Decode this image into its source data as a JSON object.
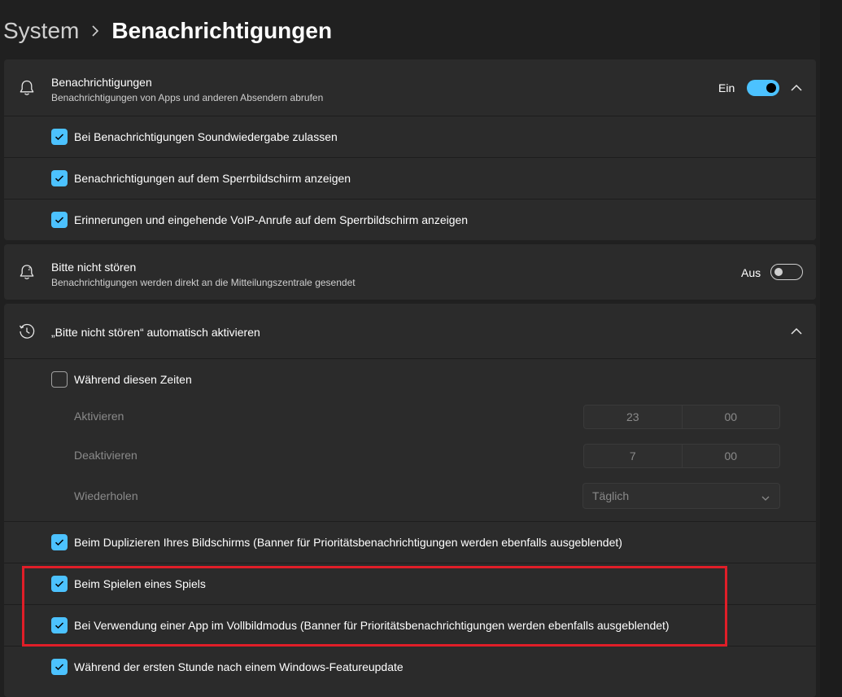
{
  "breadcrumb": {
    "parent": "System",
    "separator_icon": "chevron-right-icon",
    "current": "Benachrichtigungen"
  },
  "notifications": {
    "icon": "bell-icon",
    "title": "Benachrichtigungen",
    "subtitle": "Benachrichtigungen von Apps und anderen Absendern abrufen",
    "state_label": "Ein",
    "toggle_on": true,
    "expanded_icon": "chevron-up-icon",
    "options": [
      {
        "label": "Bei Benachrichtigungen Soundwiedergabe zulassen",
        "checked": true
      },
      {
        "label": "Benachrichtigungen auf dem Sperrbildschirm anzeigen",
        "checked": true
      },
      {
        "label": "Erinnerungen und eingehende VoIP-Anrufe auf dem Sperrbildschirm anzeigen",
        "checked": true
      }
    ]
  },
  "dnd": {
    "icon": "bell-snooze-icon",
    "title": "Bitte nicht stören",
    "subtitle": "Benachrichtigungen werden direkt an die Mitteilungszentrale gesendet",
    "state_label": "Aus",
    "toggle_on": false
  },
  "auto_dnd": {
    "icon": "clock-icon",
    "title": "„Bitte nicht stören“ automatisch aktivieren",
    "expanded_icon": "chevron-up-icon",
    "times": {
      "label": "Während diesen Zeiten",
      "checked": false,
      "activate_label": "Aktivieren",
      "activate_hour": "23",
      "activate_minute": "00",
      "deactivate_label": "Deaktivieren",
      "deactivate_hour": "7",
      "deactivate_minute": "00",
      "repeat_label": "Wiederholen",
      "repeat_value": "Täglich"
    },
    "options": [
      {
        "label": "Beim Duplizieren Ihres Bildschirms (Banner für Prioritätsbenachrichtigungen werden ebenfalls ausgeblendet)",
        "checked": true
      },
      {
        "label": "Beim Spielen eines Spiels",
        "checked": true
      },
      {
        "label": "Bei Verwendung einer App im Vollbildmodus (Banner für Prioritätsbenachrichtigungen werden ebenfalls ausgeblendet)",
        "checked": true
      },
      {
        "label": "Während der ersten Stunde nach einem Windows-Featureupdate",
        "checked": true
      }
    ]
  },
  "colors": {
    "accent": "#4cc2ff",
    "highlight": "#e01e28",
    "background": "#202020",
    "card": "#2b2b2b"
  }
}
